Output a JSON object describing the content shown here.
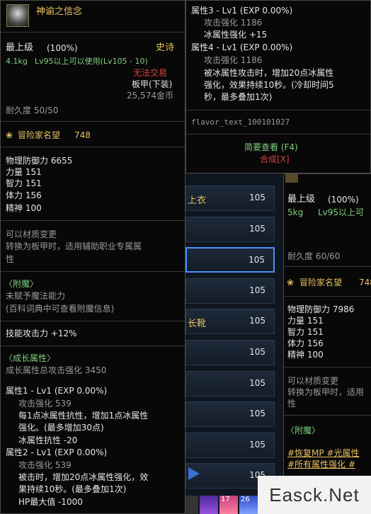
{
  "left": {
    "item_name": "神谕之信念",
    "grade": "最上级",
    "grade_pct": "(100%)",
    "rarity": "史诗",
    "weight": "4.1kg",
    "level_req": "Lv95以上可以使用(Lv105 - 10)",
    "trade": "无法交易",
    "slot": "板甲(下装)",
    "price": "25,574金币",
    "durability": "耐久度 50/50",
    "reputation_label": "冒险家名望",
    "reputation_value": "748",
    "stats": [
      "物理防御力 6655",
      "力量 151",
      "智力 151",
      "体力 156",
      "精神 100"
    ],
    "material_1": "可以材质变更",
    "material_2": "转换为板甲时，适用辅助职业专属属",
    "material_3": "性",
    "enchant_title": "〈附魔〉",
    "enchant_1": "未赋予魔法能力",
    "enchant_2": "(百科词典中可查看附魔信息)",
    "skill_atk": "技能攻击力 +12%",
    "growth_title": "〈成长属性〉",
    "growth_total": "成长属性总攻击强化 3450",
    "attr1_title": "属性1 - Lv1 (EXP 0.00%)",
    "attr1_atk": "攻击强化 539",
    "attr1_desc1": "每1点冰属性抗性，增加1点冰属性",
    "attr1_desc2": "强化。(最多增加30点)",
    "attr1_res": "冰属性抗性 -20",
    "attr2_title": "属性2 - Lv1 (EXP 0.00%)",
    "attr2_atk": "攻击强化 539",
    "attr2_desc1": "被击时，增加20点冰属性强化，效",
    "attr2_desc2": "果持续10秒。(最多叠加1次)",
    "attr2_hp": "HP最大值 -1000"
  },
  "top_right": {
    "attr3_title": "属性3 - Lv1 (EXP 0.00%)",
    "attr3_atk": "攻击强化 1186",
    "attr3_ice": "冰属性强化 +15",
    "attr4_title": "属性4 - Lv1 (EXP 0.00%)",
    "attr4_atk": "攻击强化 1186",
    "attr4_desc1": "被冰属性攻击时，增加20点冰属性",
    "attr4_desc2": "强化，效果持续10秒。(冷却时间5",
    "attr4_desc3": "秒，最多叠加1次)",
    "flavor": "flavor_text_100101027",
    "brief_view": "简要查看 (F4)",
    "compose": "合成[X]"
  },
  "middle_list": {
    "rows": [
      {
        "name": "上衣",
        "value": "105"
      },
      {
        "name": "",
        "value": "105"
      },
      {
        "name": "",
        "value": "105"
      },
      {
        "name": "",
        "value": "105"
      },
      {
        "name": "长靴",
        "value": "105"
      },
      {
        "name": "",
        "value": "105"
      },
      {
        "name": "",
        "value": "105"
      },
      {
        "name": "",
        "value": "105"
      },
      {
        "name": "",
        "value": "105"
      },
      {
        "name": "",
        "value": "105"
      }
    ],
    "hotbar_17": "17",
    "hotbar_26": "26"
  },
  "right": {
    "grade": "最上级",
    "grade_pct": "(100%)",
    "weight": "5kg",
    "level_req": "Lv95以上可",
    "durability": "耐久度 60/60",
    "reputation_label": "冒险家名望",
    "reputation_value": "748",
    "stats": [
      "物理防御力 7986",
      "力量 151",
      "智力 151",
      "体力 156",
      "精神 100"
    ],
    "material_1": "可以材质变更",
    "material_2": "转换为板甲时，适用",
    "material_3": "性",
    "enchant_title": "〈附魔〉",
    "tags_1": "#恢复MP  #光属性",
    "tags_2": "#所有属性强化  #"
  },
  "watermark": "Easck.Net"
}
